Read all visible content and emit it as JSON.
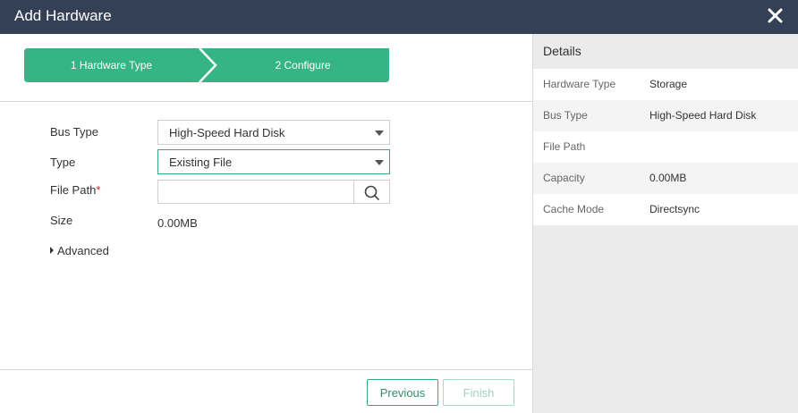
{
  "dialog": {
    "title": "Add Hardware",
    "close_icon": "close-icon"
  },
  "colors": {
    "header_bg": "#344055",
    "accent": "#35b586",
    "button_border": "#3aa979"
  },
  "stepper": {
    "steps": [
      {
        "label": "1 Hardware Type",
        "state": "done"
      },
      {
        "label": "2 Configure",
        "state": "active"
      }
    ]
  },
  "form": {
    "bus_type": {
      "label": "Bus Type",
      "value": "High-Speed Hard Disk"
    },
    "type": {
      "label": "Type",
      "value": "Existing File"
    },
    "file_path": {
      "label": "File Path",
      "required_mark": "*",
      "value": "",
      "search_icon": "search-icon"
    },
    "size": {
      "label": "Size",
      "value": "0.00MB"
    },
    "advanced": {
      "label": "Advanced"
    }
  },
  "footer": {
    "previous_label": "Previous",
    "finish_label": "Finish"
  },
  "details": {
    "title": "Details",
    "rows": [
      {
        "key": "Hardware Type",
        "value": "Storage"
      },
      {
        "key": "Bus Type",
        "value": "High-Speed Hard Disk"
      },
      {
        "key": "File Path",
        "value": ""
      },
      {
        "key": "Capacity",
        "value": "0.00MB"
      },
      {
        "key": "Cache Mode",
        "value": "Directsync"
      }
    ]
  }
}
